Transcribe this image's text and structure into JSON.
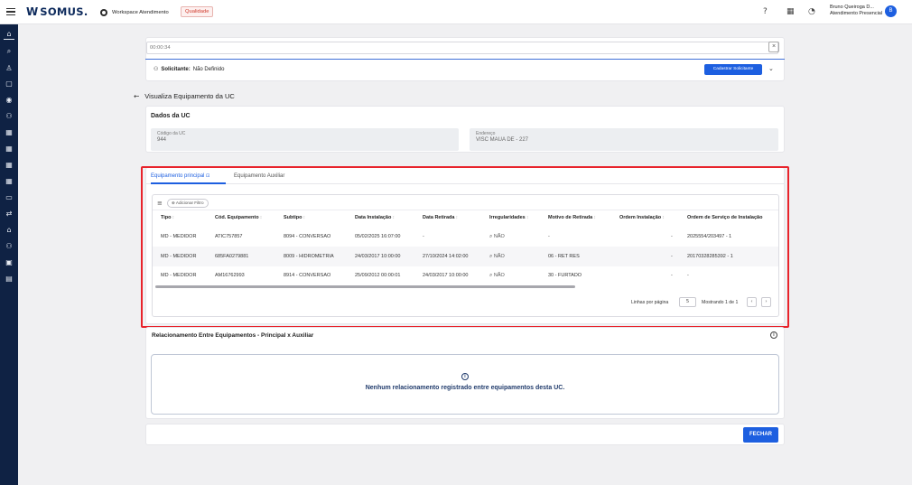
{
  "topbar": {
    "logo_mark": "W",
    "logo_text": "SOMUS.",
    "workspace_tab": "Workspace Atendimento",
    "quality_tab": "Qualidade",
    "user_name": "Bruno Queiroga D...",
    "user_role": "Atendimento Presencial",
    "user_initial": "B"
  },
  "timer": "00:00:34",
  "solicitante": {
    "label": "Solicitante:",
    "value": "Não Definido",
    "button": "Cadastrar Solicitante"
  },
  "page_title": "Visualiza Equipamento da UC",
  "dados_uc": {
    "title": "Dados da UC",
    "codigo_label": "Código da UC",
    "codigo_value": "944",
    "endereco_label": "Endereço",
    "endereco_value": "VISC MAUA DE - 227"
  },
  "tabs": [
    "Equipamento principal",
    "Equipamento Auxiliar"
  ],
  "filter_chip": "Adicionar Filtro",
  "table": {
    "columns": [
      "Tipo",
      "Cód. Equipamento",
      "Subtipo",
      "Data Instalação",
      "Data Retirada",
      "Irregularidades",
      "Motivo de Retirada",
      "Ordem Instalação",
      "Ordem de Serviço de Instalação"
    ],
    "rows": [
      [
        "MD - MEDIDOR",
        "ATIC757857",
        "8094 - CONVERSAO",
        "05/02/2025 16:07:00",
        "-",
        "NÃO",
        "-",
        "-",
        "2025554/203497 - 1"
      ],
      [
        "MD - MEDIDOR",
        "685FA0279881",
        "8009 - HIDROMETRIA",
        "24/03/2017 10:00:00",
        "27/10/2024 14:02:00",
        "NÃO",
        "06 - RET RES",
        "-",
        "20170328285392 - 1"
      ],
      [
        "MD - MEDIDOR",
        "AM16762993",
        "8914 - CONVERSAO",
        "25/09/2012 00:00:01",
        "24/03/2017 10:00:00",
        "NÃO",
        "30 - FURTADO",
        "-",
        "-"
      ]
    ]
  },
  "pagination": {
    "rows_label": "Linhas por página",
    "rows_value": "5",
    "showing": "Mostrando 1 de 1"
  },
  "relacionamento": {
    "title": "Relacionamento Entre Equipamentos - Principal x Auxiliar",
    "empty": "Nenhum relacionamento registrado entre equipamentos desta UC."
  },
  "footer": {
    "close_button": "FECHAR"
  },
  "colors": {
    "accent": "#1d5fe0",
    "sidebar": "#0f2244",
    "highlight": "#e8232b",
    "quality": "#d0392b"
  }
}
